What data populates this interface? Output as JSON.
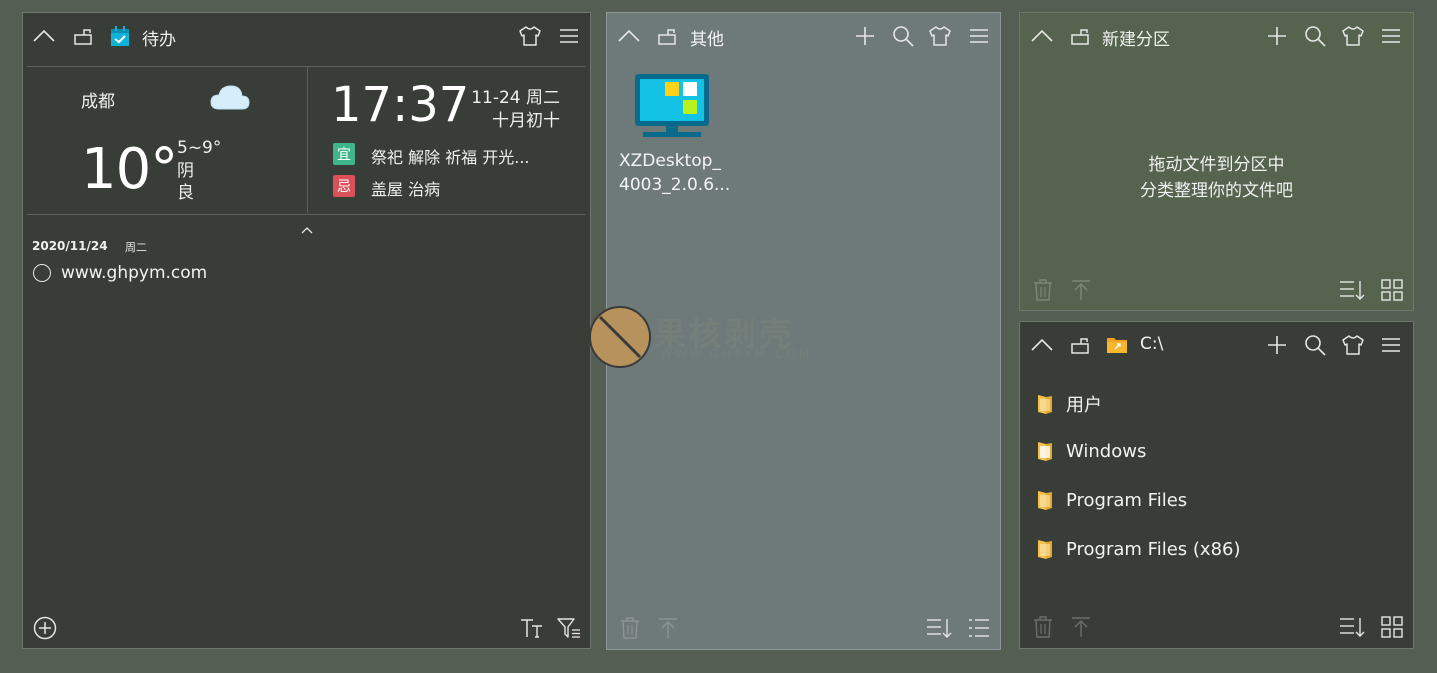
{
  "panels": {
    "todo": {
      "title": "待办",
      "weather": {
        "city": "成都",
        "temperature": "10°",
        "range": "5~9°",
        "condition": "阴",
        "air_quality": "良"
      },
      "clock": {
        "time": "17:37",
        "date": "11-24 周二",
        "lunar": "十月初十"
      },
      "almanac": {
        "good_badge": "宜",
        "good": "祭祀 解除 祈福 开光...",
        "bad_badge": "忌",
        "bad": "盖屋 治病"
      },
      "list": {
        "date": "2020/11/24",
        "weekday": "周二",
        "items": [
          "www.ghpym.com"
        ]
      }
    },
    "other": {
      "title": "其他",
      "files": [
        {
          "name_line1": "XZDesktop_",
          "name_line2": "4003_2.0.6..."
        }
      ]
    },
    "new_partition": {
      "title": "新建分区",
      "hint_line1": "拖动文件到分区中",
      "hint_line2": "分类整理你的文件吧"
    },
    "drive_c": {
      "title": "C:\\",
      "folders": [
        "用户",
        "Windows",
        "Program Files",
        "Program Files (x86)"
      ]
    }
  },
  "watermark": {
    "text": "果核剥壳",
    "sub": "WWW.GHPYM.COM"
  },
  "colors": {
    "background": "#545e53",
    "panel_dark": "#393d37",
    "panel_gray": "#6e7a79",
    "panel_green": "#56644f",
    "good_badge": "#3fb58a",
    "bad_badge": "#d9525a",
    "folder": "#f2c14e"
  }
}
